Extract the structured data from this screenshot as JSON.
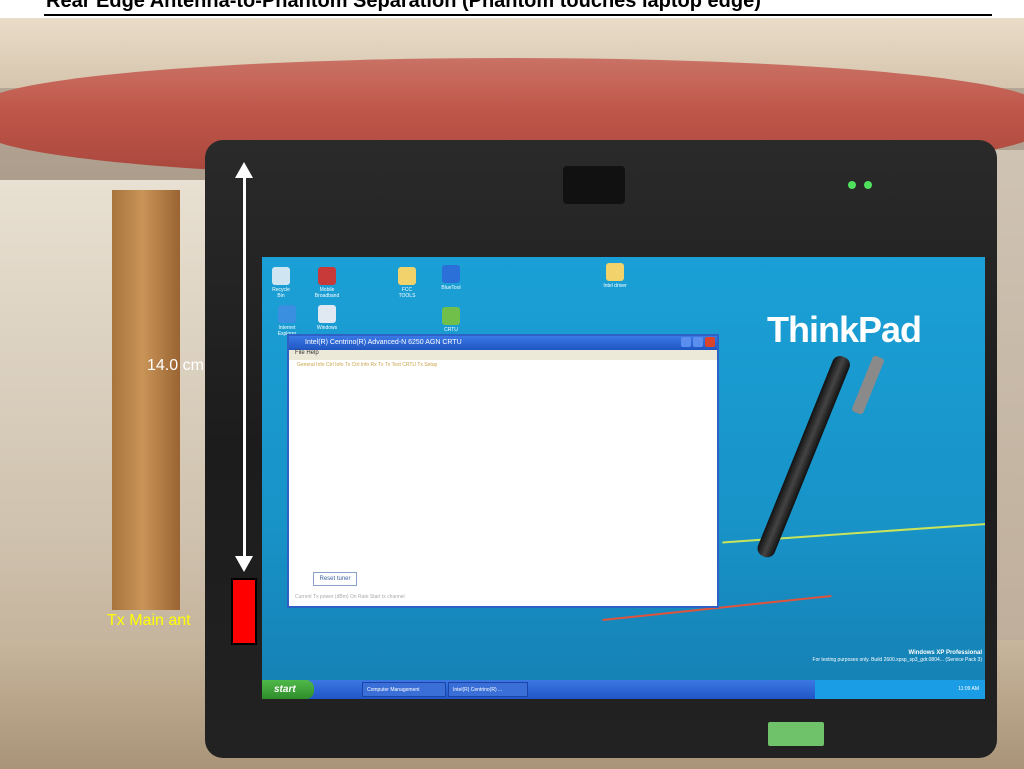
{
  "header": {
    "title": "Rear Edge Antenna-to-Phantom Separation (Phantom touches laptop edge)"
  },
  "annotations": {
    "distance_label": "14.0 cm",
    "antenna_label": "Tx Main ant"
  },
  "screen": {
    "brand_logo": "ThinkPad",
    "desktop_icons": [
      "Recycle Bin",
      "Mobile Broadband",
      "FCC TOOLS",
      "BlueTool",
      "Intel driver",
      "Internet Explorer",
      "Windows",
      "CRTU"
    ],
    "app_window": {
      "title": "Intel(R) Centrino(R) Advanced-N 6250 AGN CRTU",
      "menu": "File   Help",
      "tabs": "General Info   Ctrl Info Tx   Ctrl Info Rx   Tx Tx Test   CRTU Tx Setup",
      "button": "Reset tuner",
      "status": "Current Tx power (dBm)   On    Rate   Start tx channel"
    },
    "taskbar": {
      "start": "start",
      "task1": "Computer Management",
      "task2": "Intel(R) Centrino(R) ...",
      "tray_time": "11:09 AM"
    },
    "watermark": {
      "line1": "Windows XP Professional",
      "line2": "For testing purposes only. Build 2600.xpsp_sp3_gdr.0804... (Service Pack 3)"
    }
  },
  "colors": {
    "antenna_marker": "#ff0000",
    "antenna_label": "#ffff00",
    "distance_label": "#ffffff"
  }
}
